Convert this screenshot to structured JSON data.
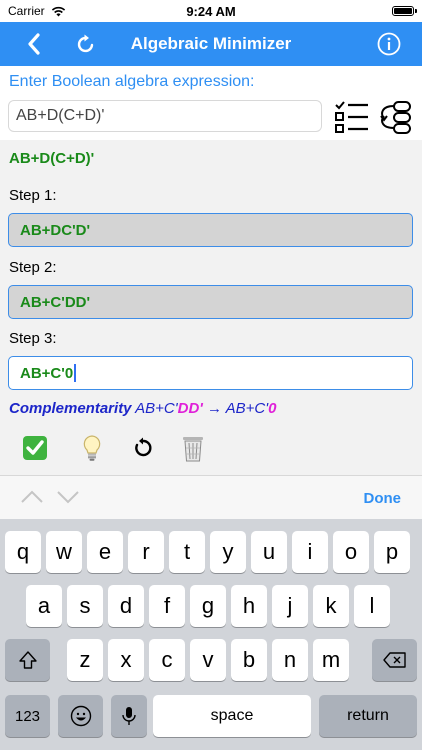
{
  "status": {
    "carrier": "Carrier",
    "time": "9:24 AM"
  },
  "nav": {
    "title": "Algebraic Minimizer"
  },
  "input": {
    "prompt": "Enter Boolean algebra expression:",
    "value": "AB+D(C+D)'"
  },
  "work": {
    "original": "AB+D(C+D)'",
    "steps": [
      {
        "label": "Step 1:",
        "value": "AB+DC'D'"
      },
      {
        "label": "Step 2:",
        "value": "AB+C'DD'"
      },
      {
        "label": "Step 3:",
        "value": "AB+C'0"
      }
    ],
    "rule": {
      "name": "Complementarity",
      "before_prefix": "AB+C'",
      "before_highlight": "DD'",
      "arrow": "→",
      "after_prefix": "AB+C'",
      "after_highlight": "0"
    },
    "actions": [
      {
        "name": "check-icon",
        "glyph": "✅"
      },
      {
        "name": "hint-bulb-icon",
        "glyph": "💡"
      },
      {
        "name": "undo-icon",
        "glyph": "↺"
      },
      {
        "name": "trash-icon",
        "glyph": "🗑"
      }
    ]
  },
  "accessory": {
    "done_label": "Done"
  },
  "keyboard": {
    "row1": [
      "q",
      "w",
      "e",
      "r",
      "t",
      "y",
      "u",
      "i",
      "o",
      "p"
    ],
    "row2": [
      "a",
      "s",
      "d",
      "f",
      "g",
      "h",
      "j",
      "k",
      "l"
    ],
    "row3": [
      "z",
      "x",
      "c",
      "v",
      "b",
      "n",
      "m"
    ],
    "numbers_label": "123",
    "space_label": "space",
    "return_label": "return"
  },
  "colors": {
    "accent": "#2f8ff3",
    "expression_green": "#1a8a1a",
    "rule_blue": "#1d26c9",
    "rule_magenta": "#e020d8",
    "keyboard_bg": "#d1d4d9"
  }
}
